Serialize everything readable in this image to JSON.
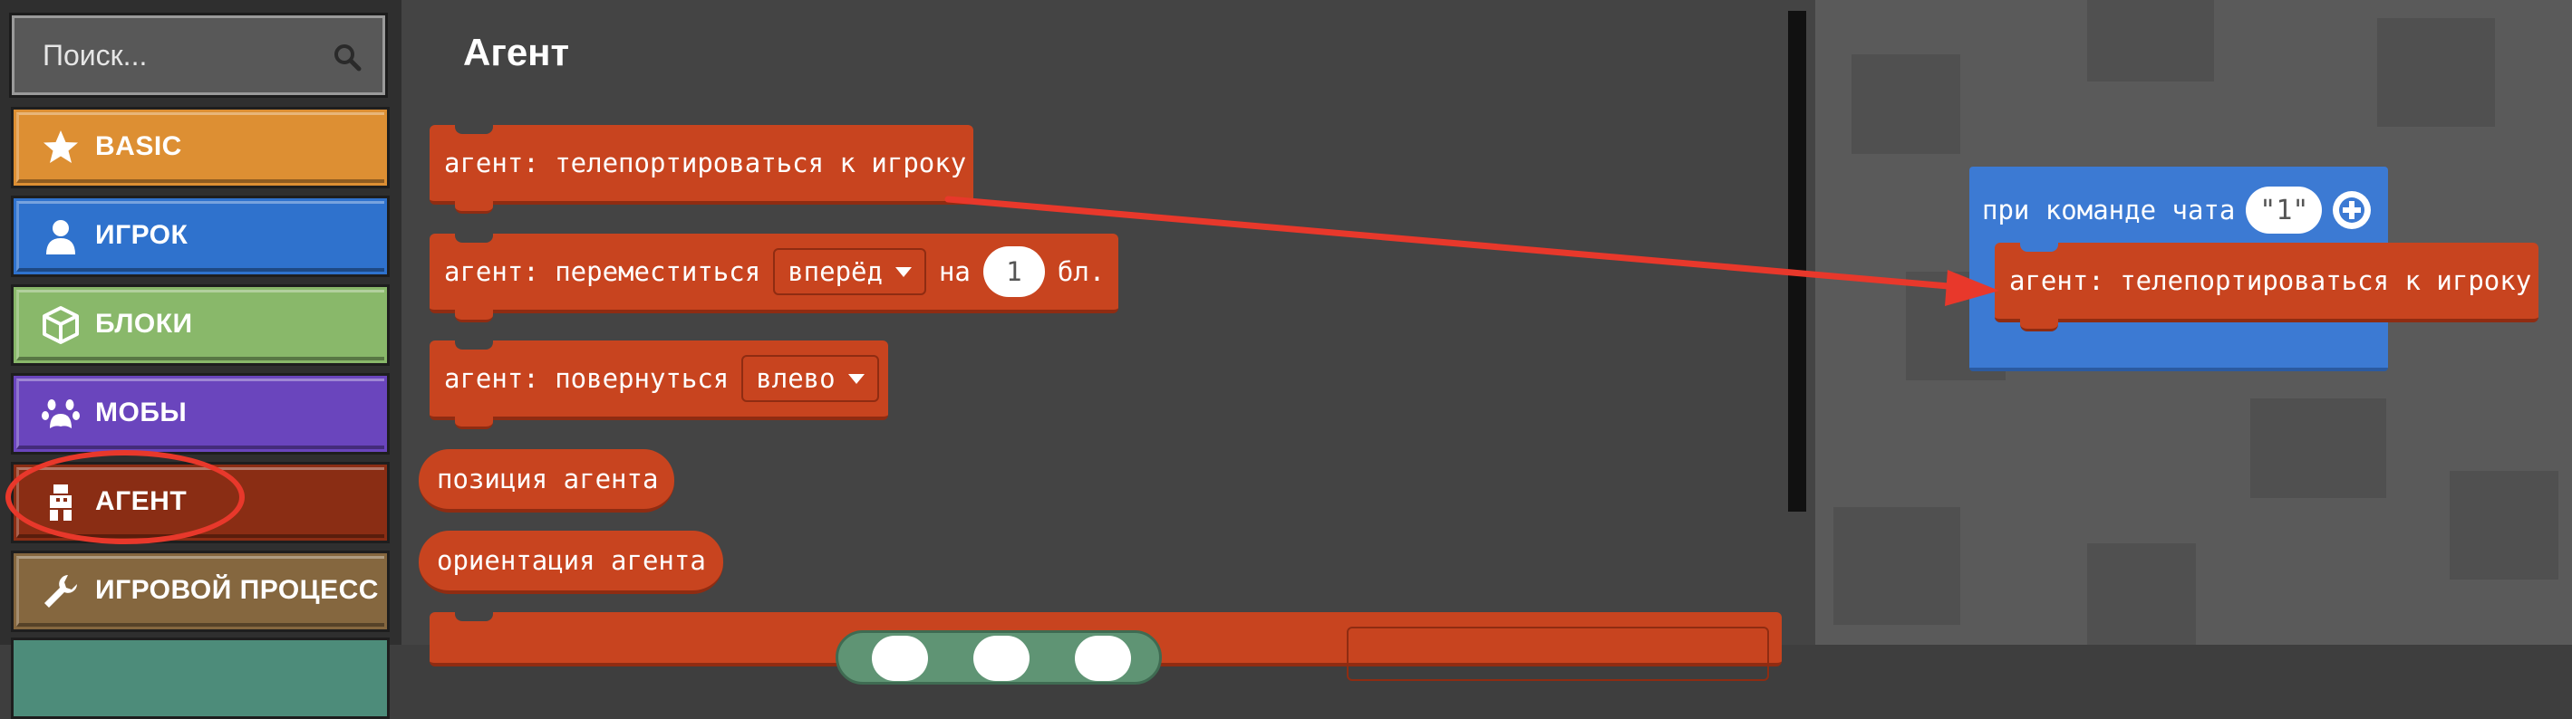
{
  "search": {
    "placeholder": "Поиск...",
    "icon": "search-icon"
  },
  "categories": [
    {
      "label": "BASIC",
      "icon": "star-icon",
      "color": "#dd8f33"
    },
    {
      "label": "ИГРОК",
      "icon": "person-icon",
      "color": "#2f72cd"
    },
    {
      "label": "БЛОКИ",
      "icon": "cube-icon",
      "color": "#89b86a"
    },
    {
      "label": "МОБЫ",
      "icon": "paw-icon",
      "color": "#6a45bd"
    },
    {
      "label": "АГЕНТ",
      "icon": "agent-icon",
      "color": "#8a2d14",
      "selected": true
    },
    {
      "label": "ИГРОВОЙ ПРОЦЕСС",
      "icon": "wrench-icon",
      "color": "#85673f"
    }
  ],
  "flyout": {
    "title": "Агент",
    "blocks": {
      "teleport": "агент: телепортироваться к игроку",
      "move_prefix": "агент: переместиться",
      "move_dir": "вперёд",
      "move_na": "на",
      "move_count": "1",
      "move_unit": "бл.",
      "turn_prefix": "агент: повернуться",
      "turn_dir": "влево",
      "position": "позиция агента",
      "orientation": "ориентация агента"
    }
  },
  "workspace": {
    "event_label": "при команде чата",
    "event_value": "\"1\"",
    "inner_block": "агент: телепортироваться к игроку"
  },
  "colors": {
    "agent_block": "#c8441f",
    "event_block": "#3c7ad3",
    "annotation_red": "#e8382b"
  }
}
